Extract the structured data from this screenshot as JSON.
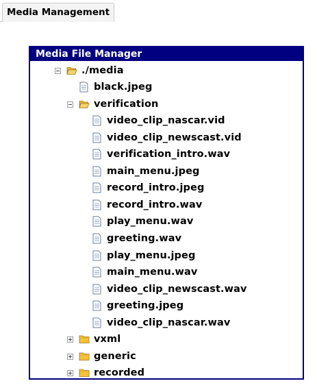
{
  "tab": {
    "label": "Media Management"
  },
  "panel": {
    "title": "Media File Manager"
  },
  "tree": {
    "root_label": "./media",
    "root_file": "black.jpeg",
    "verification_label": "verification",
    "verification_files": [
      "video_clip_nascar.vid",
      "video_clip_newscast.vid",
      "verification_intro.wav",
      "main_menu.jpeg",
      "record_intro.jpeg",
      "record_intro.wav",
      "play_menu.wav",
      "greeting.wav",
      "play_menu.jpeg",
      "main_menu.wav",
      "video_clip_newscast.wav",
      "greeting.jpeg",
      "video_clip_nascar.wav"
    ],
    "collapsed_folders": [
      "vxml",
      "generic",
      "recorded"
    ]
  },
  "colors": {
    "panel_border": "#000080",
    "header_background": "#000080",
    "folder_fill": "#f4c23b"
  }
}
